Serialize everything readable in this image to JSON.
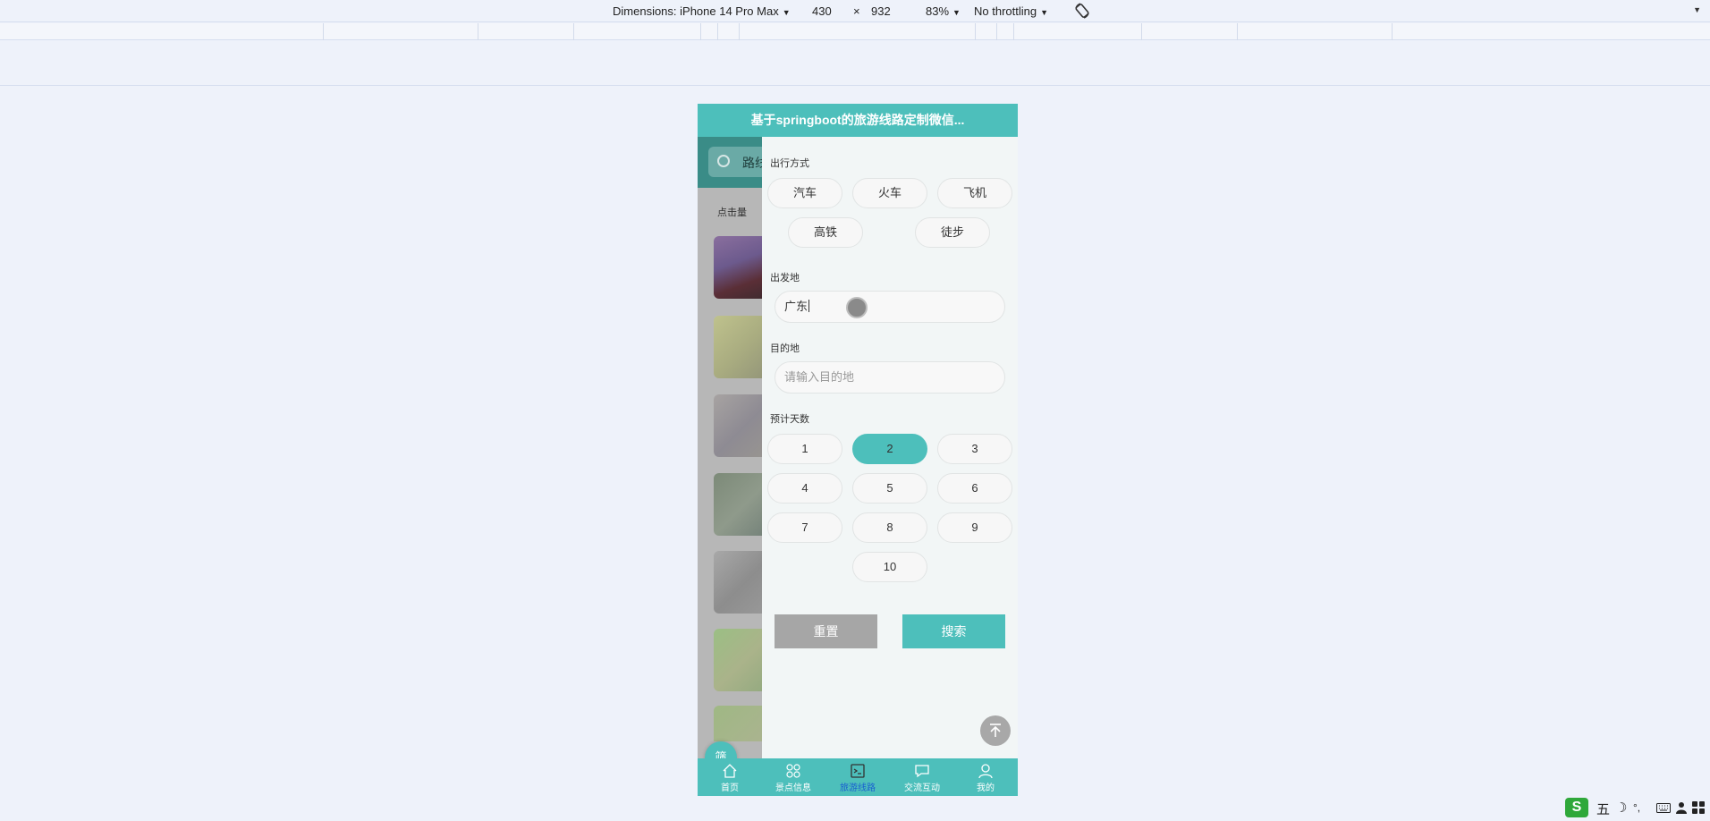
{
  "devtools": {
    "dimensions_label": "Dimensions: iPhone 14 Pro Max",
    "width": "430",
    "times": "×",
    "height": "932",
    "zoom": "83%",
    "throttling": "No throttling",
    "caret": "▼",
    "menu_icon": "▼"
  },
  "app": {
    "title": "基于springboot的旅游线路定制微信...",
    "search_placeholder": "路线",
    "clicks_label": "点击量",
    "filter_fab": "筛"
  },
  "filter": {
    "travel_mode_title": "出行方式",
    "travel_modes": [
      "汽车",
      "火车",
      "飞机",
      "高铁",
      "徒步"
    ],
    "departure_title": "出发地",
    "departure_value": "广东",
    "destination_title": "目的地",
    "destination_placeholder": "请输入目的地",
    "days_title": "预计天数",
    "days": [
      "1",
      "2",
      "3",
      "4",
      "5",
      "6",
      "7",
      "8",
      "9",
      "10"
    ],
    "selected_day": "2",
    "reset_label": "重置",
    "search_label": "搜索"
  },
  "tabs": [
    {
      "label": "首页",
      "icon": "home-icon"
    },
    {
      "label": "景点信息",
      "icon": "grid-icon"
    },
    {
      "label": "旅游线路",
      "icon": "route-icon",
      "active": true
    },
    {
      "label": "交流互动",
      "icon": "chat-icon"
    },
    {
      "label": "我的",
      "icon": "user-icon"
    }
  ],
  "ime": {
    "logo": "S",
    "mode": "五",
    "moon": "☽",
    "punct": "°,"
  },
  "colors": {
    "accent": "#4dbfbb",
    "reset_button": "#a6a6a6",
    "active_tab_label": "#1a5fd0"
  }
}
